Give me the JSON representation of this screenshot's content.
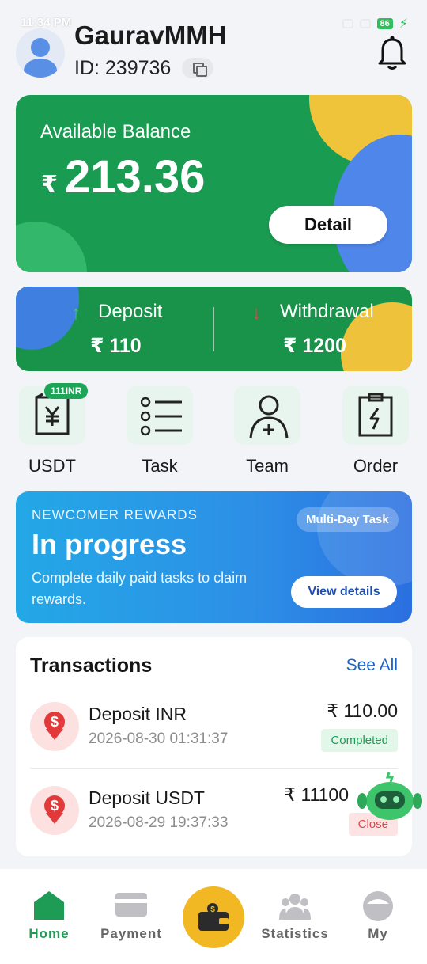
{
  "status_bar": {
    "time": "11:34 PM",
    "battery": "86"
  },
  "user": {
    "name": "GauravMMH",
    "id_label": "ID:  239736"
  },
  "balance": {
    "label": "Available Balance",
    "currency": "₹",
    "amount": "213.36",
    "detail_button": "Detail"
  },
  "flows": {
    "deposit_label": "Deposit",
    "deposit_value": "₹ 110",
    "withdrawal_label": "Withdrawal",
    "withdrawal_value": "₹ 1200"
  },
  "quick_actions": [
    {
      "label": "USDT",
      "icon": "receipt-yen-icon",
      "badge": "111INR"
    },
    {
      "label": "Task",
      "icon": "list-icon"
    },
    {
      "label": "Team",
      "icon": "add-user-icon"
    },
    {
      "label": "Order",
      "icon": "clipboard-bolt-icon"
    }
  ],
  "rewards": {
    "kicker": "NEWCOMER REWARDS",
    "title": "In progress",
    "description": "Complete daily paid tasks to claim rewards.",
    "tag": "Multi-Day Task",
    "button": "View details"
  },
  "transactions": {
    "title": "Transactions",
    "see_all": "See All",
    "items": [
      {
        "name": "Deposit INR",
        "date": "2026-08-30 01:31:37",
        "amount": "₹ 110.00",
        "status": "Completed"
      },
      {
        "name": "Deposit USDT",
        "date": "2026-08-29 19:37:33",
        "amount": "₹ 11100",
        "status": "Close"
      }
    ]
  },
  "bottom_nav": [
    {
      "label": "Home",
      "icon": "home-icon",
      "active": true
    },
    {
      "label": "Payment",
      "icon": "card-icon"
    },
    {
      "label": "",
      "icon": "wallet-icon"
    },
    {
      "label": "Statistics",
      "icon": "people-icon"
    },
    {
      "label": "My",
      "icon": "profile-icon"
    }
  ],
  "colors": {
    "brand_green": "#199b51",
    "accent_yellow": "#f2b824",
    "accent_blue": "#2d8fe6"
  }
}
